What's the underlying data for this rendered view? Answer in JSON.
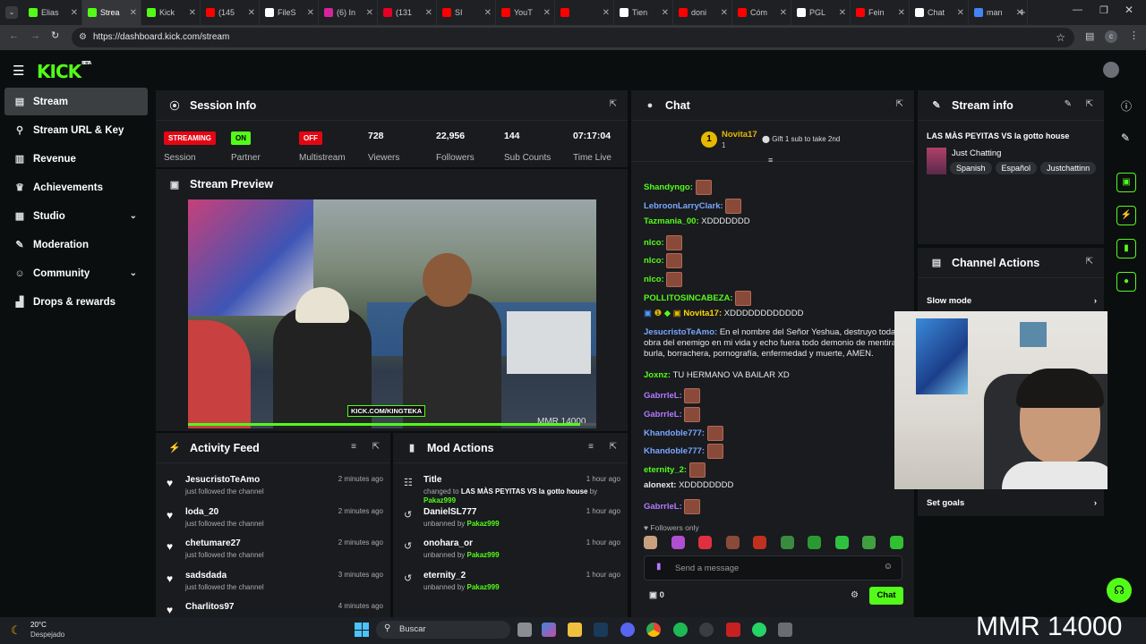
{
  "browser": {
    "tabs": [
      {
        "label": "Elias",
        "color": "#53fc18"
      },
      {
        "label": "Strea",
        "color": "#53fc18"
      },
      {
        "label": "Kick",
        "color": "#53fc18"
      },
      {
        "label": "(145",
        "color": "#ff0000"
      },
      {
        "label": "FileS",
        "color": "#ffffff"
      },
      {
        "label": "(6) In",
        "color": "#d6249f"
      },
      {
        "label": "(131",
        "color": "#e60023"
      },
      {
        "label": "SI",
        "color": "#ff0000"
      },
      {
        "label": "YouT",
        "color": "#ff0000"
      },
      {
        "label": "",
        "color": "#ff0000"
      },
      {
        "label": "Tien",
        "color": "#ffffff"
      },
      {
        "label": "doni",
        "color": "#ff0000"
      },
      {
        "label": "Cóm",
        "color": "#ff0000"
      },
      {
        "label": "PGL",
        "color": "#ffffff"
      },
      {
        "label": "Fein",
        "color": "#ff0000"
      },
      {
        "label": "Chat",
        "color": "#ffffff"
      },
      {
        "label": "man",
        "color": "#4285f4"
      }
    ],
    "url": "https://dashboard.kick.com/stream"
  },
  "brand": {
    "logo": "KICK",
    "beta": "BETA",
    "accent": "#53fc18"
  },
  "sidebar": {
    "items": [
      {
        "label": "Stream",
        "icon": "stream-icon",
        "glyph": "▤"
      },
      {
        "label": "Stream URL & Key",
        "icon": "link-icon",
        "glyph": "⚲"
      },
      {
        "label": "Revenue",
        "icon": "revenue-icon",
        "glyph": "▥"
      },
      {
        "label": "Achievements",
        "icon": "trophy-icon",
        "glyph": "♛"
      },
      {
        "label": "Studio",
        "icon": "studio-icon",
        "glyph": "▦"
      },
      {
        "label": "Moderation",
        "icon": "wrench-icon",
        "glyph": "✎"
      },
      {
        "label": "Community",
        "icon": "community-icon",
        "glyph": "☺"
      },
      {
        "label": "Drops & rewards",
        "icon": "gift-icon",
        "glyph": "▟"
      }
    ]
  },
  "session": {
    "title": "Session Info",
    "streaming_badge": "STREAMING",
    "streaming_label": "Session",
    "partner_badge": "ON",
    "partner_label": "Partner",
    "multistream_badge": "OFF",
    "multistream_label": "Multistream",
    "viewers": "728",
    "viewers_label": "Viewers",
    "followers": "22,956",
    "followers_label": "Followers",
    "subs": "144",
    "subs_label": "Sub Counts",
    "time": "07:17:04",
    "time_label": "Time Live"
  },
  "preview": {
    "title": "Stream Preview",
    "watermark": "KICK.COM/KINGTEKA",
    "overlay": "MMR 14000"
  },
  "activity": {
    "title": "Activity Feed",
    "items": [
      {
        "name": "JesucristoTeAmo",
        "action": "just followed the channel",
        "time": "2 minutes ago"
      },
      {
        "name": "loda_20",
        "action": "just followed the channel",
        "time": "2 minutes ago"
      },
      {
        "name": "chetumare27",
        "action": "just followed the channel",
        "time": "2 minutes ago"
      },
      {
        "name": "sadsdada",
        "action": "just followed the channel",
        "time": "3 minutes ago"
      },
      {
        "name": "Charlitos97",
        "action": "",
        "time": "4 minutes ago"
      }
    ]
  },
  "mod": {
    "title": "Mod Actions",
    "items": [
      {
        "name": "Title",
        "pre": "changed to",
        "target": "LAS MÀS PEYITAS VS la gotto house",
        "by": "by",
        "mod": "Pakaz999",
        "time": "1 hour ago"
      },
      {
        "name": "DanielSL777",
        "pre": "unbanned by",
        "mod": "Pakaz999",
        "time": "1 hour ago"
      },
      {
        "name": "onohara_or",
        "pre": "unbanned by",
        "mod": "Pakaz999",
        "time": "1 hour ago"
      },
      {
        "name": "eternity_2",
        "pre": "unbanned by",
        "mod": "Pakaz999",
        "time": "1 hour ago"
      }
    ]
  },
  "chat": {
    "title": "Chat",
    "top_user": "Novita17",
    "top_rank": "1",
    "top_sub": "1",
    "gift_text": "Gift 1 sub to take 2nd",
    "messages": [
      {
        "user": "Shandyngo:",
        "color": "#53fc18",
        "text": "",
        "emotes": 1
      },
      {
        "user": "LebroonLarryClark:",
        "color": "#7aa7ff",
        "text": "",
        "emotes": 1
      },
      {
        "user": "Tazmania_00:",
        "color": "#53fc18",
        "text": "XDDDDDDD",
        "emotes": 0
      },
      {
        "user": "nlco:",
        "color": "#53fc18",
        "text": "",
        "emotes": 1
      },
      {
        "user": "nlco:",
        "color": "#53fc18",
        "text": "",
        "emotes": 1
      },
      {
        "user": "nlco:",
        "color": "#53fc18",
        "text": "",
        "emotes": 1
      },
      {
        "user": "POLLITOSINCABEZA:",
        "color": "#53fc18",
        "text": "",
        "emotes": 1
      },
      {
        "user": "Novita17:",
        "color": "#ffd700",
        "text": "XDDDDDDDDDDDD",
        "emotes": 0
      },
      {
        "user": "JesucristoTeAmo:",
        "color": "#7aa7ff",
        "text": "En el nombre del Señor Yeshua, destruyo toda obra del enemigo en mi vida y echo fuera todo demonio de mentira, burla, borrachera, pornografía, enfermedad y muerte, AMEN.",
        "emotes": 0
      },
      {
        "user": "Joxnz:",
        "color": "#53fc18",
        "text": "TU HERMANO VA BAILAR XD",
        "emotes": 0
      },
      {
        "user": "GabrrleL:",
        "color": "#b57aff",
        "text": "",
        "emotes": 1
      },
      {
        "user": "GabrrleL:",
        "color": "#b57aff",
        "text": "",
        "emotes": 1
      },
      {
        "user": "Khandoble777:",
        "color": "#7aa7ff",
        "text": "",
        "emotes": 1
      },
      {
        "user": "Khandoble777:",
        "color": "#7aa7ff",
        "text": "",
        "emotes": 1
      },
      {
        "user": "eternity_2:",
        "color": "#53fc18",
        "text": "",
        "emotes": 1
      },
      {
        "user": "alonext:",
        "color": "#e8e8e8",
        "text": "XDDDDDDDD",
        "emotes": 0
      },
      {
        "user": "GabrrleL:",
        "color": "#b57aff",
        "text": "",
        "emotes": 1
      }
    ],
    "followers_only": "Followers only",
    "placeholder": "Send a message",
    "points": "0",
    "send_label": "Chat"
  },
  "stream_info": {
    "title": "Stream info",
    "stream_title": "LAS MÀS PEYITAS VS la gotto house",
    "category": "Just Chatting",
    "tags": [
      "Spanish",
      "Español",
      "Justchattinn"
    ]
  },
  "channel_actions": {
    "title": "Channel Actions",
    "slow_mode": "Slow mode",
    "set_goals": "Set goals"
  },
  "taskbar": {
    "temp": "20°C",
    "weather": "Despejado",
    "search": "Buscar",
    "overlay": "MMR 14000"
  }
}
